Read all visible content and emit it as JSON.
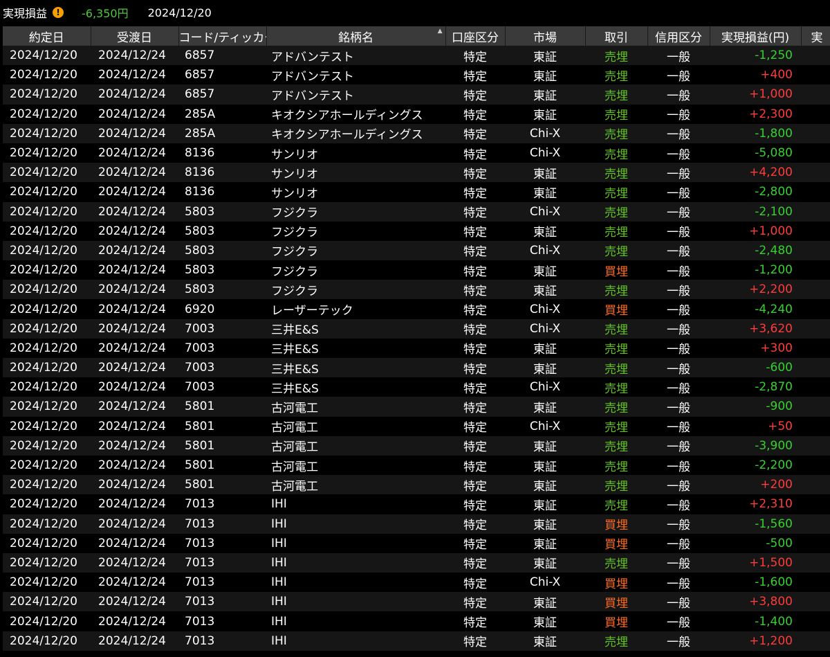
{
  "summary": {
    "label": "実現損益",
    "value": "-6,350円",
    "date": "2024/12/20",
    "warn_glyph": "!"
  },
  "columns": [
    "約定日",
    "受渡日",
    "コード/ティッカー",
    "銘柄名",
    "口座区分",
    "市場",
    "取引",
    "信用区分",
    "実現損益(円)",
    "実"
  ],
  "rows": [
    {
      "trade_date": "2024/12/20",
      "settle_date": "2024/12/24",
      "code": "6857",
      "name": "アドバンテスト",
      "account": "特定",
      "market": "東証",
      "trade": "売埋",
      "credit": "一般",
      "pl": "-1,250"
    },
    {
      "trade_date": "2024/12/20",
      "settle_date": "2024/12/24",
      "code": "6857",
      "name": "アドバンテスト",
      "account": "特定",
      "market": "東証",
      "trade": "売埋",
      "credit": "一般",
      "pl": "+400"
    },
    {
      "trade_date": "2024/12/20",
      "settle_date": "2024/12/24",
      "code": "6857",
      "name": "アドバンテスト",
      "account": "特定",
      "market": "東証",
      "trade": "売埋",
      "credit": "一般",
      "pl": "+1,000"
    },
    {
      "trade_date": "2024/12/20",
      "settle_date": "2024/12/24",
      "code": "285A",
      "name": "キオクシアホールディングス",
      "account": "特定",
      "market": "東証",
      "trade": "売埋",
      "credit": "一般",
      "pl": "+2,300"
    },
    {
      "trade_date": "2024/12/20",
      "settle_date": "2024/12/24",
      "code": "285A",
      "name": "キオクシアホールディングス",
      "account": "特定",
      "market": "Chi-X",
      "trade": "売埋",
      "credit": "一般",
      "pl": "-1,800"
    },
    {
      "trade_date": "2024/12/20",
      "settle_date": "2024/12/24",
      "code": "8136",
      "name": "サンリオ",
      "account": "特定",
      "market": "Chi-X",
      "trade": "売埋",
      "credit": "一般",
      "pl": "-5,080"
    },
    {
      "trade_date": "2024/12/20",
      "settle_date": "2024/12/24",
      "code": "8136",
      "name": "サンリオ",
      "account": "特定",
      "market": "東証",
      "trade": "売埋",
      "credit": "一般",
      "pl": "+4,200"
    },
    {
      "trade_date": "2024/12/20",
      "settle_date": "2024/12/24",
      "code": "8136",
      "name": "サンリオ",
      "account": "特定",
      "market": "東証",
      "trade": "売埋",
      "credit": "一般",
      "pl": "-2,800"
    },
    {
      "trade_date": "2024/12/20",
      "settle_date": "2024/12/24",
      "code": "5803",
      "name": "フジクラ",
      "account": "特定",
      "market": "Chi-X",
      "trade": "売埋",
      "credit": "一般",
      "pl": "-2,100"
    },
    {
      "trade_date": "2024/12/20",
      "settle_date": "2024/12/24",
      "code": "5803",
      "name": "フジクラ",
      "account": "特定",
      "market": "東証",
      "trade": "売埋",
      "credit": "一般",
      "pl": "+1,000"
    },
    {
      "trade_date": "2024/12/20",
      "settle_date": "2024/12/24",
      "code": "5803",
      "name": "フジクラ",
      "account": "特定",
      "market": "Chi-X",
      "trade": "売埋",
      "credit": "一般",
      "pl": "-2,480"
    },
    {
      "trade_date": "2024/12/20",
      "settle_date": "2024/12/24",
      "code": "5803",
      "name": "フジクラ",
      "account": "特定",
      "market": "東証",
      "trade": "買埋",
      "credit": "一般",
      "pl": "-1,200"
    },
    {
      "trade_date": "2024/12/20",
      "settle_date": "2024/12/24",
      "code": "5803",
      "name": "フジクラ",
      "account": "特定",
      "market": "東証",
      "trade": "売埋",
      "credit": "一般",
      "pl": "+2,200"
    },
    {
      "trade_date": "2024/12/20",
      "settle_date": "2024/12/24",
      "code": "6920",
      "name": "レーザーテック",
      "account": "特定",
      "market": "Chi-X",
      "trade": "買埋",
      "credit": "一般",
      "pl": "-4,240"
    },
    {
      "trade_date": "2024/12/20",
      "settle_date": "2024/12/24",
      "code": "7003",
      "name": "三井E&S",
      "account": "特定",
      "market": "Chi-X",
      "trade": "売埋",
      "credit": "一般",
      "pl": "+3,620"
    },
    {
      "trade_date": "2024/12/20",
      "settle_date": "2024/12/24",
      "code": "7003",
      "name": "三井E&S",
      "account": "特定",
      "market": "東証",
      "trade": "売埋",
      "credit": "一般",
      "pl": "+300"
    },
    {
      "trade_date": "2024/12/20",
      "settle_date": "2024/12/24",
      "code": "7003",
      "name": "三井E&S",
      "account": "特定",
      "market": "東証",
      "trade": "売埋",
      "credit": "一般",
      "pl": "-600"
    },
    {
      "trade_date": "2024/12/20",
      "settle_date": "2024/12/24",
      "code": "7003",
      "name": "三井E&S",
      "account": "特定",
      "market": "Chi-X",
      "trade": "売埋",
      "credit": "一般",
      "pl": "-2,870"
    },
    {
      "trade_date": "2024/12/20",
      "settle_date": "2024/12/24",
      "code": "5801",
      "name": "古河電工",
      "account": "特定",
      "market": "東証",
      "trade": "売埋",
      "credit": "一般",
      "pl": "-900"
    },
    {
      "trade_date": "2024/12/20",
      "settle_date": "2024/12/24",
      "code": "5801",
      "name": "古河電工",
      "account": "特定",
      "market": "Chi-X",
      "trade": "売埋",
      "credit": "一般",
      "pl": "+50"
    },
    {
      "trade_date": "2024/12/20",
      "settle_date": "2024/12/24",
      "code": "5801",
      "name": "古河電工",
      "account": "特定",
      "market": "東証",
      "trade": "売埋",
      "credit": "一般",
      "pl": "-3,900"
    },
    {
      "trade_date": "2024/12/20",
      "settle_date": "2024/12/24",
      "code": "5801",
      "name": "古河電工",
      "account": "特定",
      "market": "東証",
      "trade": "売埋",
      "credit": "一般",
      "pl": "-2,200"
    },
    {
      "trade_date": "2024/12/20",
      "settle_date": "2024/12/24",
      "code": "5801",
      "name": "古河電工",
      "account": "特定",
      "market": "東証",
      "trade": "売埋",
      "credit": "一般",
      "pl": "+200"
    },
    {
      "trade_date": "2024/12/20",
      "settle_date": "2024/12/24",
      "code": "7013",
      "name": "IHI",
      "account": "特定",
      "market": "東証",
      "trade": "売埋",
      "credit": "一般",
      "pl": "+2,310"
    },
    {
      "trade_date": "2024/12/20",
      "settle_date": "2024/12/24",
      "code": "7013",
      "name": "IHI",
      "account": "特定",
      "market": "東証",
      "trade": "買埋",
      "credit": "一般",
      "pl": "-1,560"
    },
    {
      "trade_date": "2024/12/20",
      "settle_date": "2024/12/24",
      "code": "7013",
      "name": "IHI",
      "account": "特定",
      "market": "東証",
      "trade": "買埋",
      "credit": "一般",
      "pl": "-500"
    },
    {
      "trade_date": "2024/12/20",
      "settle_date": "2024/12/24",
      "code": "7013",
      "name": "IHI",
      "account": "特定",
      "market": "東証",
      "trade": "売埋",
      "credit": "一般",
      "pl": "+1,500"
    },
    {
      "trade_date": "2024/12/20",
      "settle_date": "2024/12/24",
      "code": "7013",
      "name": "IHI",
      "account": "特定",
      "market": "Chi-X",
      "trade": "買埋",
      "credit": "一般",
      "pl": "-1,600"
    },
    {
      "trade_date": "2024/12/20",
      "settle_date": "2024/12/24",
      "code": "7013",
      "name": "IHI",
      "account": "特定",
      "market": "東証",
      "trade": "買埋",
      "credit": "一般",
      "pl": "+3,800"
    },
    {
      "trade_date": "2024/12/20",
      "settle_date": "2024/12/24",
      "code": "7013",
      "name": "IHI",
      "account": "特定",
      "market": "東証",
      "trade": "買埋",
      "credit": "一般",
      "pl": "-1,400"
    },
    {
      "trade_date": "2024/12/20",
      "settle_date": "2024/12/24",
      "code": "7013",
      "name": "IHI",
      "account": "特定",
      "market": "東証",
      "trade": "売埋",
      "credit": "一般",
      "pl": "+1,200"
    }
  ],
  "colors": {
    "positive": "#ff3b3b",
    "negative": "#35d12e",
    "sell_close": "#63c421",
    "buy_close": "#ff6a1a",
    "summary_value": "#4fc93a",
    "warn": "#f5a000",
    "header_bg": "#3a3a3a"
  },
  "icons": {
    "warning": "warning-icon",
    "sort": "sort-ascending-icon"
  }
}
